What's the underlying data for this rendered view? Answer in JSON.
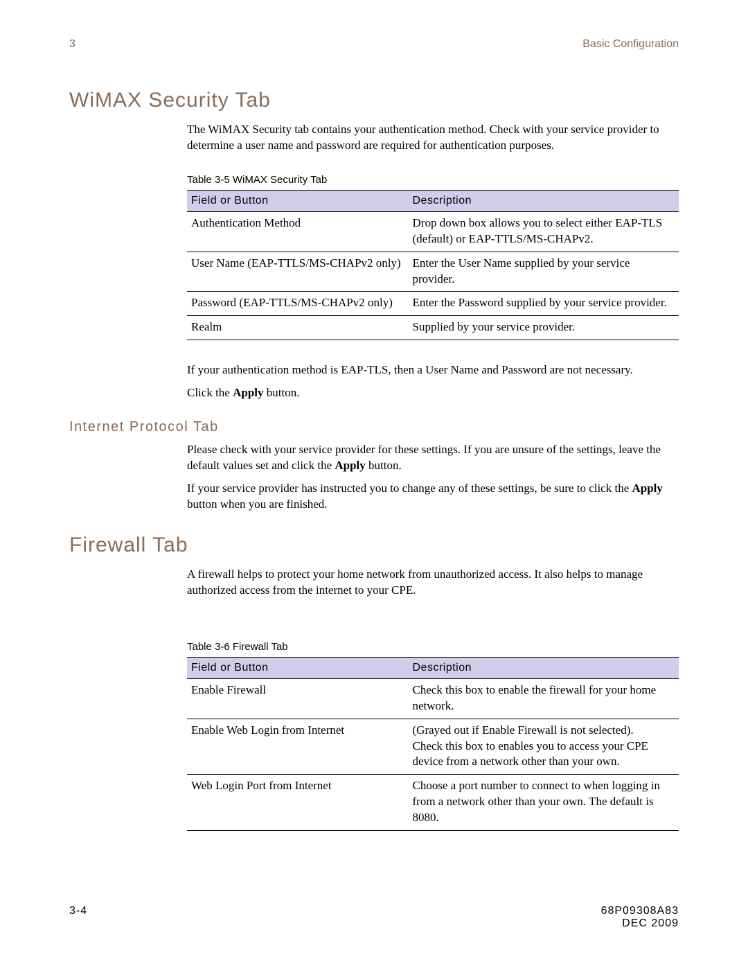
{
  "header": {
    "left": "3",
    "right": "Basic Configuration"
  },
  "section1": {
    "title": "WiMAX Security Tab",
    "para1": "The WiMAX Security tab contains your authentication method. Check with your service provider to determine a user name and password are required for authentication purposes.",
    "table_caption": "Table 3-5 WiMAX Security Tab",
    "col_field": "Field or Button",
    "col_desc": "Description",
    "rows": [
      {
        "field": "Authentication Method",
        "desc": "Drop down box allows you to select either EAP-TLS (default) or EAP-TTLS/MS-CHAPv2."
      },
      {
        "field": "User Name (EAP-TTLS/MS-CHAPv2 only)",
        "desc": "Enter the User Name supplied by your service provider."
      },
      {
        "field": "Password (EAP-TTLS/MS-CHAPv2 only)",
        "desc": "Enter the Password supplied by your service provider."
      },
      {
        "field": "Realm",
        "desc": "Supplied by your service provider."
      }
    ],
    "para2": "If your authentication method is EAP-TLS, then a User Name and Password are not necessary.",
    "para3_pre": "Click the ",
    "para3_bold": "Apply",
    "para3_post": " button."
  },
  "section2": {
    "title": "Internet Protocol Tab",
    "para1_pre": "Please check with your service provider for these settings. If you are unsure of the settings, leave the default values set and click the ",
    "para1_bold": "Apply",
    "para1_post": " button.",
    "para2_pre": "If your service provider has instructed you to change any of these settings, be sure to click the ",
    "para2_bold": "Apply",
    "para2_post": " button when you are finished."
  },
  "section3": {
    "title": "Firewall Tab",
    "para1": "A firewall helps to protect your home network from unauthorized access. It also helps to manage authorized access from the internet to your CPE.",
    "table_caption": "Table 3-6 Firewall Tab",
    "col_field": "Field or Button",
    "col_desc": "Description",
    "rows": [
      {
        "field": "Enable Firewall",
        "desc": "Check this box to enable the firewall for your home network."
      },
      {
        "field": "Enable Web Login from Internet",
        "desc": "(Grayed out if Enable Firewall is not selected).\nCheck this box to enables you to access your CPE device from a network other than your own."
      },
      {
        "field": "Web Login Port from Internet",
        "desc": "Choose a port number to connect to when logging in from a network other than your own. The default is 8080."
      }
    ]
  },
  "footer": {
    "left": "3-4",
    "right_line1": "68P09308A83",
    "right_line2": "DEC 2009"
  }
}
